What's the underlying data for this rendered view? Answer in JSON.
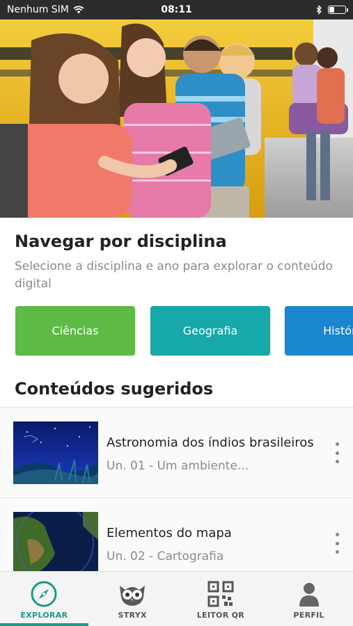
{
  "status_bar": {
    "carrier": "Nenhum SIM",
    "time": "08:11",
    "battery_level": 0.3
  },
  "hero": {
    "image": "children-using-tablets-photo"
  },
  "browse": {
    "title": "Navegar por disciplina",
    "subtitle": "Selecione a disciplina e ano para explorar o conteúdo digital",
    "disciplines": [
      {
        "label": "Ciências",
        "color": "#5dbb46"
      },
      {
        "label": "Geografia",
        "color": "#17a8aa"
      },
      {
        "label": "História",
        "color": "#1a86d0"
      }
    ]
  },
  "suggested": {
    "title": "Conteúdos sugeridos",
    "items": [
      {
        "title": "Astronomia dos índios brasileiros",
        "subtitle": "Un. 01 - Um ambiente...",
        "thumb": "night-sky-thumbnail"
      },
      {
        "title": "Elementos do mapa",
        "subtitle": "Un. 02 - Cartografia",
        "thumb": "globe-map-thumbnail"
      }
    ]
  },
  "tabs": [
    {
      "label": "EXPLORAR",
      "icon": "compass-icon",
      "active": true
    },
    {
      "label": "STRYX",
      "icon": "owl-icon",
      "active": false
    },
    {
      "label": "LEITOR QR",
      "icon": "qr-code-icon",
      "active": false
    },
    {
      "label": "PERFIL",
      "icon": "person-icon",
      "active": false
    }
  ],
  "colors": {
    "accent": "#1b9a87",
    "status_bar": "#2c2c2c"
  }
}
